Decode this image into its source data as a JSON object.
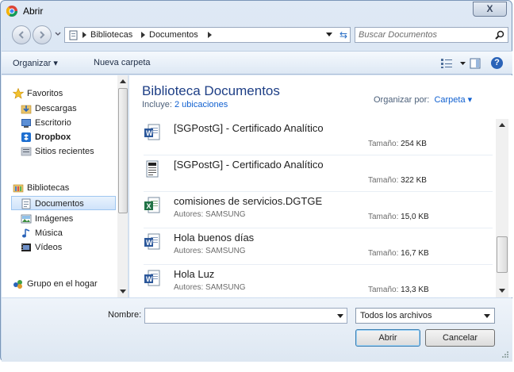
{
  "window": {
    "title": "Abrir",
    "close_label": "X"
  },
  "address": {
    "crumbs": [
      "Bibliotecas",
      "Documentos"
    ]
  },
  "search": {
    "placeholder": "Buscar Documentos"
  },
  "toolbar": {
    "organizar": "Organizar ▾",
    "nueva_carpeta": "Nueva carpeta",
    "help": "?"
  },
  "navpane": {
    "items": [
      {
        "label": "Favoritos",
        "icon": "star-icon"
      },
      {
        "label": "Descargas",
        "icon": "downloads-folder-icon"
      },
      {
        "label": "Escritorio",
        "icon": "desktop-icon"
      },
      {
        "label": "Dropbox",
        "icon": "dropbox-icon"
      },
      {
        "label": "Sitios recientes",
        "icon": "recent-places-icon"
      },
      {
        "label": "Bibliotecas",
        "icon": "libraries-icon"
      },
      {
        "label": "Documentos",
        "icon": "documents-icon"
      },
      {
        "label": "Imágenes",
        "icon": "pictures-icon"
      },
      {
        "label": "Música",
        "icon": "music-icon"
      },
      {
        "label": "Vídeos",
        "icon": "videos-icon"
      },
      {
        "label": "Grupo en el hogar",
        "icon": "homegroup-icon"
      }
    ],
    "selected": "Documentos"
  },
  "library": {
    "title": "Biblioteca Documentos",
    "includes_prefix": "Incluye:",
    "includes_link": "2 ubicaciones",
    "arrange_prefix": "Organizar por:",
    "arrange_value": "Carpeta ▾"
  },
  "files": [
    {
      "name": "[SGPostG] - Certificado Analítico",
      "author": "",
      "size_label": "Tamaño:",
      "size": "254 KB",
      "icon": "word-doc-icon"
    },
    {
      "name": "[SGPostG] - Certificado Analítico",
      "author": "",
      "size_label": "Tamaño:",
      "size": "322 KB",
      "icon": "generic-doc-icon"
    },
    {
      "name": "comisiones de servicios.DGTGE",
      "author": "Autores: SAMSUNG",
      "size_label": "Tamaño:",
      "size": "15,0 KB",
      "icon": "excel-doc-icon"
    },
    {
      "name": "Hola buenos días",
      "author": "Autores: SAMSUNG",
      "size_label": "Tamaño:",
      "size": "16,7 KB",
      "icon": "word-doc-icon"
    },
    {
      "name": "Hola Luz",
      "author": "Autores: SAMSUNG",
      "size_label": "Tamaño:",
      "size": "13,3 KB",
      "icon": "word-doc-icon"
    }
  ],
  "bottom": {
    "name_label": "Nombre:",
    "name_value": "",
    "file_type": "Todos los archivos",
    "open_label": "Abrir",
    "cancel_label": "Cancelar"
  },
  "colors": {
    "accent": "#1e3f86",
    "link": "#1060d0",
    "selection": "#cfe3fa"
  }
}
